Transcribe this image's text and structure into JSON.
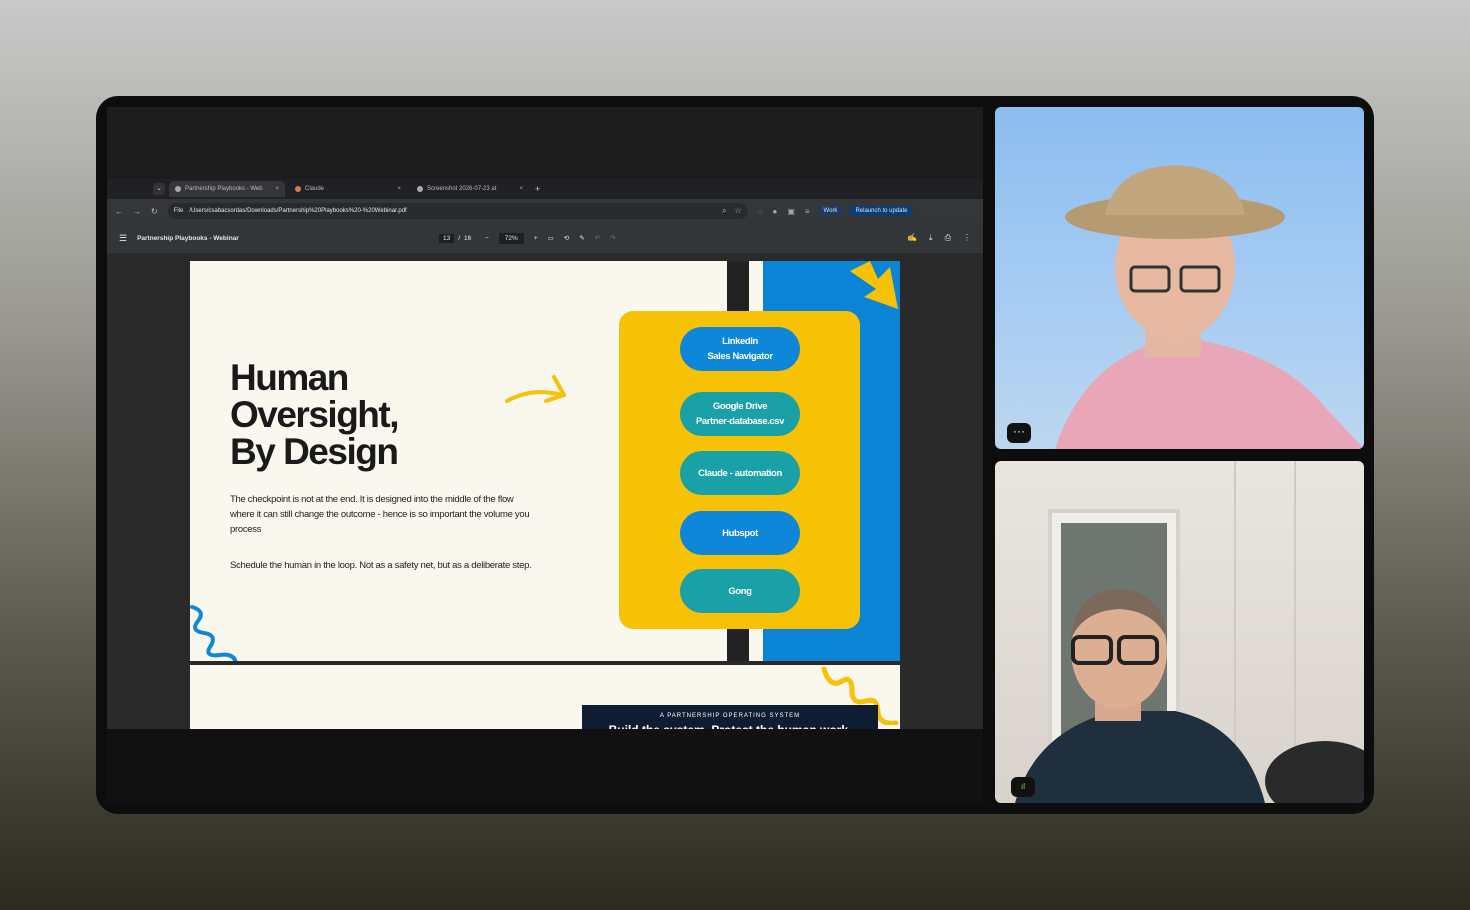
{
  "browser": {
    "tabs": [
      {
        "label": "Partnership Playbooks - Web",
        "close": "×"
      },
      {
        "label": "Claude",
        "close": "×"
      },
      {
        "label": "Screenshot 2026-07-23 at",
        "close": "×"
      }
    ],
    "new_tab": "+",
    "dropdown": "⌄",
    "nav": {
      "back": "←",
      "forward": "→",
      "reload": "↻"
    },
    "address": {
      "scheme": "File",
      "path": "/Users/csabacsordas/Downloads/Partnership%20Playbooks%20-%20Webinar.pdf"
    },
    "profile": "Work",
    "relaunch": "Relaunch to update"
  },
  "pdf_toolbar": {
    "menu": "☰",
    "title": "Partnership Playbooks - Webinar",
    "page_current": "13",
    "page_sep": "/",
    "page_total": "16",
    "zoom_out": "−",
    "zoom": "72%",
    "zoom_in": "+"
  },
  "slide": {
    "heading_lines": [
      "Human",
      "Oversight,",
      "By Design"
    ],
    "para1": "The checkpoint is not at the end. It is designed into the middle of the flow where it can still change the outcome - hence is so important the volume you process",
    "para2": "Schedule the human in the loop. Not as a safety net, but as a deliberate step.",
    "pills": [
      {
        "line1": "LinkedIn",
        "line2": "Sales Navigator"
      },
      {
        "line1": "Google Drive",
        "line2": "Partner-database.csv"
      },
      {
        "line1": "Claude - automation",
        "line2": ""
      },
      {
        "line1": "Hubspot",
        "line2": ""
      },
      {
        "line1": "Gong",
        "line2": ""
      }
    ],
    "colors": {
      "yellow": "#f7c106",
      "blue": "#0b84d6",
      "teal": "#1aa1a8"
    }
  },
  "next_slide": {
    "kicker": "A PARTNERSHIP OPERATING SYSTEM",
    "headline": "Build the system. Protect the human work."
  },
  "participants": {
    "more_label": "···",
    "mic_label": "ıl"
  }
}
